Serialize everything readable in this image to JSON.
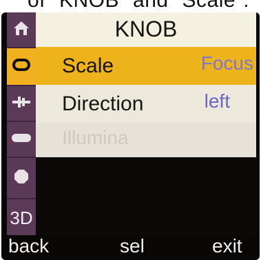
{
  "caption": "of \"KNOB\" and \"Scale\":",
  "menu": {
    "title": "KNOB",
    "rows": [
      {
        "label": "Scale",
        "value": "Focus",
        "state": "selected"
      },
      {
        "label": "Direction",
        "value": "left",
        "state": "normal"
      },
      {
        "label": "Illumina",
        "value": "",
        "state": "disabled"
      }
    ]
  },
  "sidebar": {
    "items": [
      {
        "icon": "home-icon",
        "label": ""
      },
      {
        "icon": "knob-icon",
        "label": ""
      },
      {
        "icon": "slider-icon",
        "label": ""
      },
      {
        "icon": "bar-icon",
        "label": ""
      },
      {
        "icon": "octagon-icon",
        "label": ""
      },
      {
        "icon": "",
        "label": "3D"
      }
    ]
  },
  "softkeys": {
    "left": "back",
    "middle": "sel",
    "right": "exit"
  },
  "colors": {
    "highlight": "#eeb21a",
    "sidebar": "#5b3a58",
    "value_text": "#7d78c8"
  }
}
